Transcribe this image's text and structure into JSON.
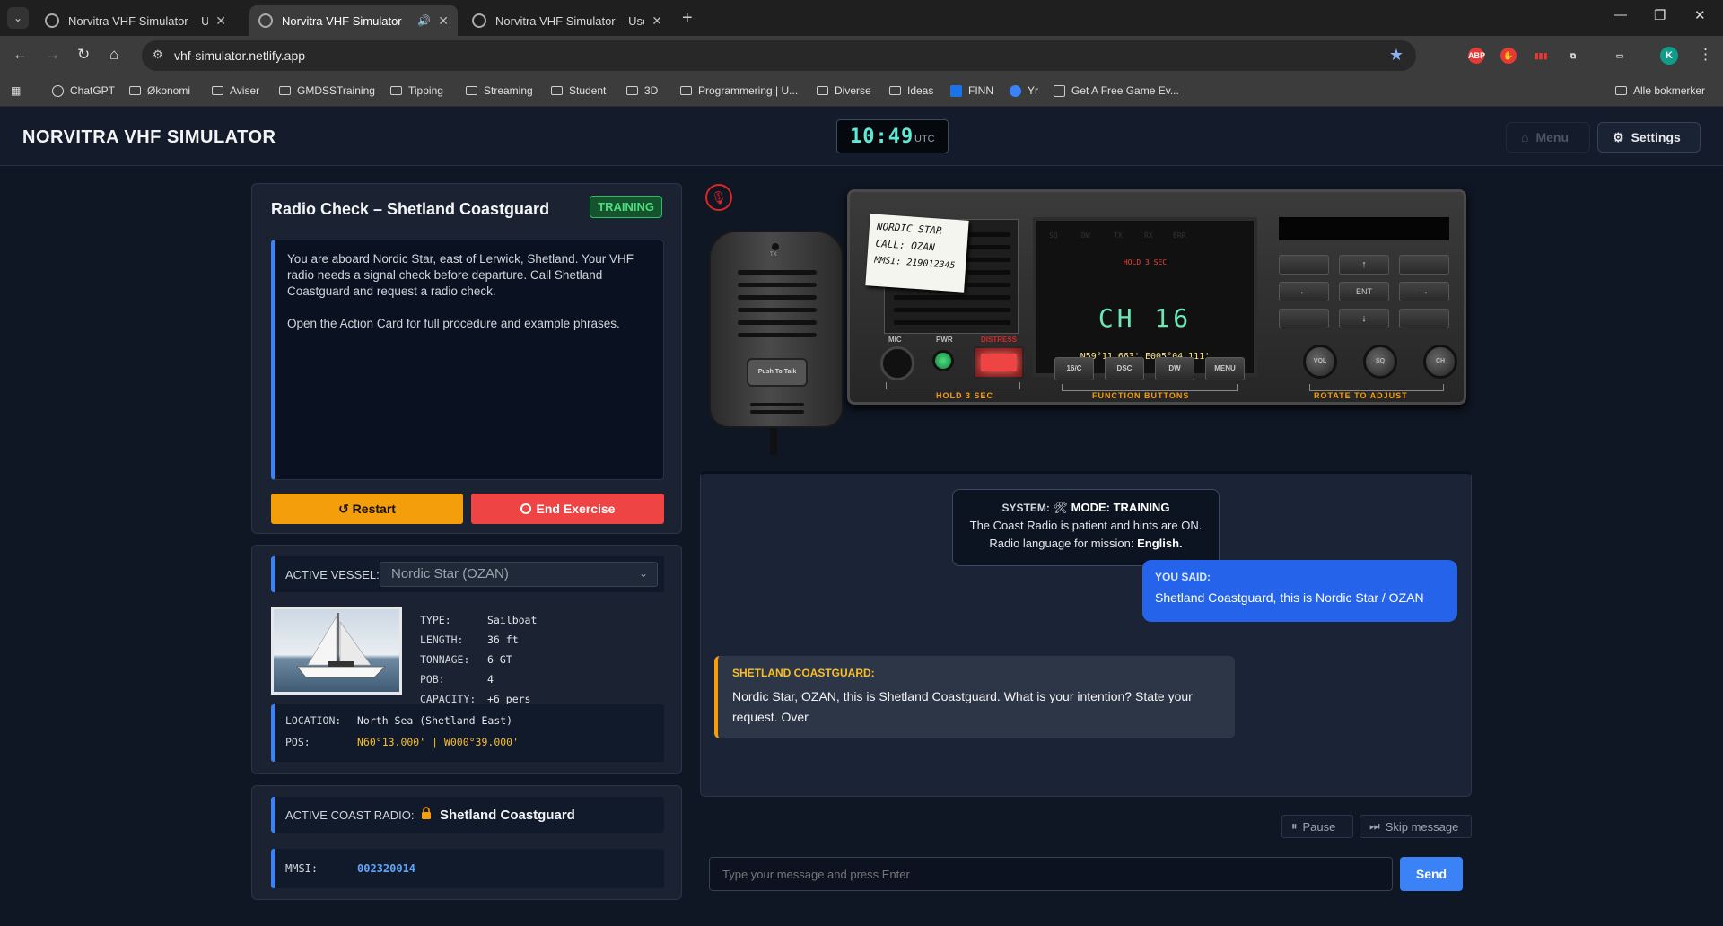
{
  "browser": {
    "tabs": [
      {
        "title": "Norvitra VHF Simulator – User Guide",
        "active": false
      },
      {
        "title": "Norvitra VHF Simulator",
        "active": true
      },
      {
        "title": "Norvitra VHF Simulator – User Guide",
        "active": false
      }
    ],
    "url": "vhf-simulator.netlify.app",
    "profile_initial": "K",
    "bookmarks": [
      "ChatGPT",
      "Økonomi",
      "Aviser",
      "GMDSSTraining",
      "Tipping",
      "Streaming",
      "Student",
      "3D",
      "Programmering | U...",
      "Diverse",
      "Ideas",
      "FINN",
      "Yr",
      "Get A Free Game Ev..."
    ],
    "all_bookmarks": "Alle bokmerker",
    "ext_abp": "ABP"
  },
  "header": {
    "title": "NORVITRA VHF SIMULATOR",
    "clock_time": "10:49",
    "clock_zone": "UTC",
    "menu_label": "Menu",
    "settings_label": "Settings"
  },
  "scenario": {
    "title": "Radio Check – Shetland Coastguard",
    "badge": "TRAINING",
    "brief_p1": "You are aboard Nordic Star, east of Lerwick, Shetland. Your VHF radio needs a signal check before departure. Call Shetland Coastguard and request a radio check.",
    "brief_p2": "Open the Action Card for full procedure and example phrases.",
    "restart_label": "↺ Restart",
    "end_label": "End Exercise"
  },
  "vessel": {
    "label": "ACTIVE VESSEL:",
    "selected": "Nordic Star (OZAN)",
    "specs": [
      {
        "k": "TYPE:",
        "v": "Sailboat"
      },
      {
        "k": "LENGTH:",
        "v": "36 ft"
      },
      {
        "k": "TONNAGE:",
        "v": "6 GT"
      },
      {
        "k": "POB:",
        "v": "4"
      },
      {
        "k": "CAPACITY:",
        "v": "+6 pers"
      }
    ],
    "location_k": "LOCATION:",
    "location_v": "North Sea (Shetland East)",
    "pos_k": "POS:",
    "pos_v": "N60°13.000' | W000°39.000'"
  },
  "coast": {
    "label": "ACTIVE COAST RADIO:",
    "name": "Shetland Coastguard",
    "mmsi_k": "MMSI:",
    "mmsi_v": "002320014"
  },
  "radio": {
    "handset_tx": "TX",
    "ptt_label": "Push To Talk",
    "sticker_l1": "NORDIC STAR",
    "sticker_l2": "CALL: OZAN",
    "sticker_l3": "MMSI: 219012345",
    "indicators": [
      "SQ",
      "DW",
      "TX",
      "RX",
      "ERR"
    ],
    "hold_msg": "HOLD 3 SEC",
    "channel": "CH 16",
    "position": "N59°11.663' E005°04.111'",
    "lbl_mic": "MIC",
    "lbl_pwr": "PWR",
    "lbl_distress": "DISTRESS",
    "fn_buttons": [
      "16/C",
      "DSC",
      "DW",
      "MENU"
    ],
    "knobs": [
      "VOL",
      "SQ",
      "CH"
    ],
    "keypad": [
      "",
      "↑",
      "",
      "←",
      "ENT",
      "→",
      "",
      "↓",
      ""
    ],
    "hold_label": "HOLD 3 SEC",
    "function_label": "FUNCTION BUTTONS",
    "rotate_label": "ROTATE TO ADJUST"
  },
  "chat": {
    "system_label": "SYSTEM:",
    "system_icon": "🛠",
    "system_mode": "MODE: TRAINING",
    "system_line2": "The Coast Radio is patient and hints are ON.",
    "system_line3_pre": "Radio language for mission:",
    "system_lang": "English.",
    "user_label": "YOU SAID:",
    "user_text": "Shetland Coastguard, this is Nordic Star / OZAN",
    "coast_label": "SHETLAND COASTGUARD:",
    "coast_text": "Nordic Star, OZAN, this is Shetland Coastguard. What is your intention? State your request. Over",
    "pause_label": "Pause",
    "skip_label": "Skip message",
    "input_placeholder": "Type your message and press Enter",
    "send_label": "Send"
  }
}
